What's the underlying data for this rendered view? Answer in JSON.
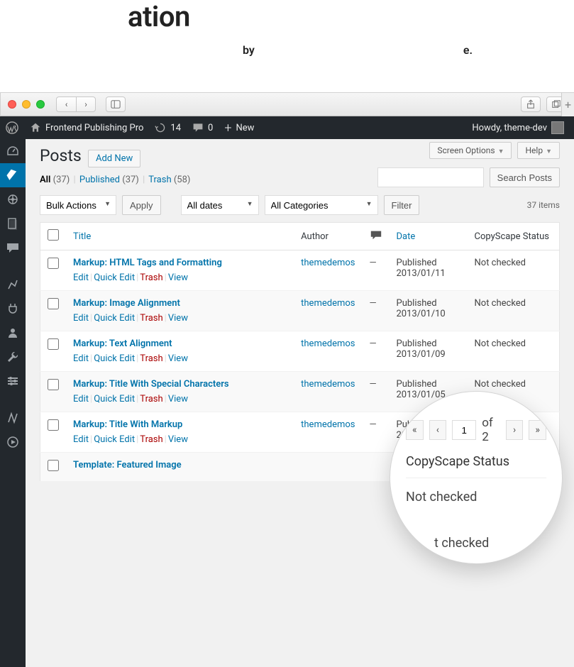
{
  "hero": {
    "title_suffix": "ation",
    "subtitle_fragment_1": "by",
    "subtitle_fragment_2": "e."
  },
  "adminbar": {
    "site_name": "Frontend Publishing Pro",
    "updates_count": "14",
    "comments_count": "0",
    "new_label": "New",
    "greeting": "Howdy, theme-dev"
  },
  "screen_options": "Screen Options",
  "help": "Help",
  "page": {
    "heading": "Posts",
    "add_new": "Add New"
  },
  "filters": {
    "all_label": "All",
    "all_count": "(37)",
    "published_label": "Published",
    "published_count": "(37)",
    "trash_label": "Trash",
    "trash_count": "(58)"
  },
  "search": {
    "button": "Search Posts"
  },
  "bulk_actions": {
    "label": "Bulk Actions",
    "apply": "Apply"
  },
  "date_filter": "All dates",
  "cat_filter": "All Categories",
  "filter_btn": "Filter",
  "items_count": "37 items",
  "columns": {
    "title": "Title",
    "author": "Author",
    "date": "Date",
    "copyscape": "CopyScape Status"
  },
  "row_actions": {
    "edit": "Edit",
    "quick_edit": "Quick Edit",
    "trash": "Trash",
    "view": "View"
  },
  "posts": [
    {
      "title": "Markup: HTML Tags and Formatting",
      "author": "themedemos",
      "comments": "—",
      "date_status": "Published",
      "date": "2013/01/11",
      "copyscape": "Not checked"
    },
    {
      "title": "Markup: Image Alignment",
      "author": "themedemos",
      "comments": "—",
      "date_status": "Published",
      "date": "2013/01/10",
      "copyscape": "Not checked"
    },
    {
      "title": "Markup: Text Alignment",
      "author": "themedemos",
      "comments": "—",
      "date_status": "Published",
      "date": "2013/01/09",
      "copyscape": "Not checked"
    },
    {
      "title": "Markup: Title With Special Characters",
      "author": "themedemos",
      "comments": "—",
      "date_status": "Published",
      "date": "2013/01/05",
      "copyscape": "Not checked"
    },
    {
      "title": "Markup: Title With Markup",
      "author": "themedemos",
      "comments": "—",
      "date_status": "Published",
      "date": "2013/01/05",
      "copyscape": "Not checked"
    },
    {
      "title": "Template: Featured Image",
      "author": "",
      "comments": "",
      "date_status": "",
      "date": "",
      "copyscape": ""
    }
  ],
  "lens": {
    "page_value": "1",
    "of_label": "of 2",
    "header": "CopyScape Status",
    "value1": "Not checked",
    "value2": "t checked"
  }
}
